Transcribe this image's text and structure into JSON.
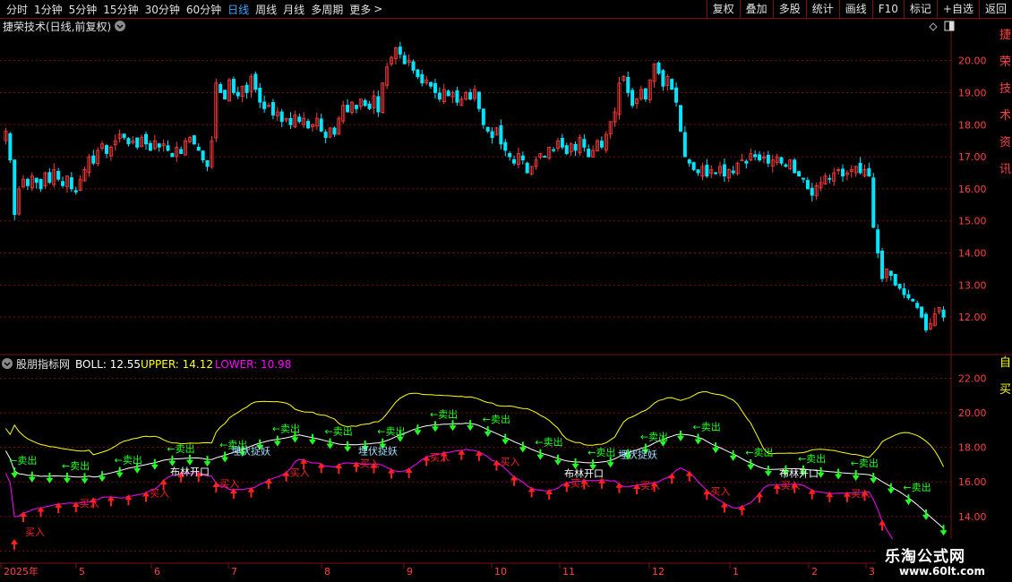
{
  "toolbar": {
    "periods": [
      "分时",
      "1分钟",
      "5分钟",
      "15分钟",
      "30分钟",
      "60分钟",
      "日线",
      "周线",
      "月线",
      "多周期",
      "更多"
    ],
    "active": "日线",
    "more_arrow": ">",
    "right_buttons": [
      "复权",
      "叠加",
      "多股",
      "统计",
      "画线",
      "F10",
      "标记",
      "+自选",
      "返回"
    ]
  },
  "main_panel": {
    "title": "捷荣技术(日线,前复权)",
    "y_ticks": [
      "20.00",
      "19.00",
      "18.00",
      "17.00",
      "16.00",
      "15.00",
      "14.00",
      "13.00",
      "12.00"
    ],
    "side_text": "捷荣技术资讯"
  },
  "sub_panel": {
    "indicator_name": "股朋指标网",
    "boll_label": "BOLL: 12.55",
    "upper_label": "UPPER: 14.12",
    "lower_label": "LOWER: 10.98",
    "y_ticks": [
      "22.00",
      "20.00",
      "18.00",
      "16.00",
      "14.00",
      "12.00"
    ],
    "side_text": "自买"
  },
  "x_axis": {
    "labels": [
      "2025年",
      "5",
      "6",
      "7",
      "8",
      "9",
      "10",
      "11",
      "12",
      "1",
      "2",
      "3"
    ]
  },
  "signals": {
    "buy": "买入",
    "sell": "卖出",
    "sell_arrow": "←卖出",
    "ambush": "埋伏捉妖",
    "gap": "布林开口"
  },
  "colors": {
    "up": "#ff3b3b",
    "down": "#00e5ff",
    "grid": "#7a1010",
    "mid": "#ffffff",
    "upper": "#ffff00",
    "lower": "#ff00ff",
    "buy": "#ff2020",
    "sell": "#20ff20"
  },
  "watermark": {
    "name": "乐淘公式网",
    "url": "www.60lt.com"
  },
  "chart_data": {
    "type": "candlestick",
    "price_range": [
      11.0,
      20.8
    ],
    "boll_range": [
      11.5,
      22.6
    ],
    "closes": [
      17.8,
      16.9,
      15.2,
      16.0,
      16.3,
      16.1,
      16.4,
      16.2,
      16.0,
      16.5,
      16.2,
      16.6,
      16.3,
      16.1,
      16.4,
      16.0,
      15.9,
      16.3,
      16.6,
      17.0,
      16.8,
      17.2,
      17.4,
      17.1,
      17.3,
      17.5,
      17.7,
      17.6,
      17.4,
      17.5,
      17.3,
      17.6,
      17.4,
      17.2,
      17.5,
      17.3,
      17.4,
      17.2,
      17.0,
      17.3,
      17.1,
      17.5,
      17.6,
      17.4,
      17.2,
      16.9,
      16.7,
      17.5,
      19.3,
      19.0,
      18.8,
      19.4,
      19.0,
      18.9,
      19.2,
      19.0,
      19.5,
      19.1,
      18.7,
      18.5,
      18.6,
      18.3,
      18.4,
      18.1,
      18.2,
      18.0,
      18.3,
      18.1,
      18.2,
      17.9,
      18.0,
      18.2,
      17.8,
      17.6,
      17.9,
      17.7,
      18.2,
      18.6,
      18.4,
      18.7,
      18.5,
      18.8,
      18.6,
      18.5,
      18.9,
      18.4,
      19.3,
      19.8,
      20.1,
      20.4,
      20.2,
      19.9,
      20.0,
      19.7,
      19.5,
      19.3,
      19.4,
      19.2,
      19.0,
      18.8,
      19.1,
      18.9,
      19.0,
      18.7,
      18.8,
      19.0,
      18.8,
      19.1,
      18.5,
      18.0,
      17.8,
      17.6,
      17.9,
      17.4,
      17.2,
      17.0,
      16.8,
      17.1,
      16.9,
      16.5,
      16.7,
      16.9,
      17.1,
      17.0,
      17.3,
      17.2,
      17.5,
      17.3,
      17.1,
      17.4,
      17.2,
      17.6,
      17.3,
      17.0,
      17.2,
      17.5,
      17.3,
      17.7,
      18.1,
      18.4,
      19.3,
      19.5,
      19.0,
      18.6,
      18.8,
      19.1,
      18.8,
      19.4,
      19.9,
      19.6,
      19.2,
      19.5,
      19.1,
      18.7,
      17.8,
      17.0,
      16.8,
      16.6,
      16.5,
      16.7,
      16.4,
      16.6,
      16.5,
      16.7,
      16.4,
      16.6,
      16.5,
      16.8,
      16.9,
      16.8,
      17.1,
      17.0,
      16.9,
      17.0,
      16.8,
      16.9,
      17.0,
      16.8,
      16.7,
      16.9,
      16.5,
      16.4,
      16.3,
      16.0,
      15.8,
      16.1,
      16.2,
      16.4,
      16.3,
      16.5,
      16.6,
      16.4,
      16.5,
      16.6,
      16.7,
      16.5,
      16.6,
      16.4,
      14.8,
      14.0,
      13.2,
      13.5,
      13.3,
      13.0,
      12.9,
      12.7,
      12.6,
      12.5,
      12.3,
      12.0,
      11.6,
      11.8,
      12.1,
      12.3,
      12.0
    ]
  }
}
